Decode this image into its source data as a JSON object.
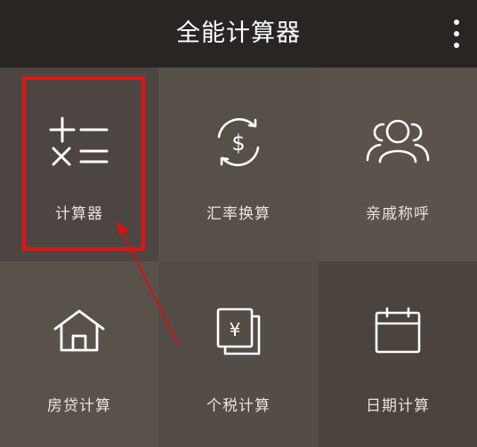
{
  "app": {
    "title": "全能计算器"
  },
  "tiles": [
    {
      "label": "计算器",
      "icon": "calculator-icon",
      "color": "#4d4541"
    },
    {
      "label": "汇率换算",
      "icon": "currency-exchange-icon",
      "color": "#575049"
    },
    {
      "label": "亲戚称呼",
      "icon": "people-group-icon",
      "color": "#5a524b"
    },
    {
      "label": "房贷计算",
      "icon": "house-icon",
      "color": "#59524a"
    },
    {
      "label": "个税计算",
      "icon": "tax-document-icon",
      "color": "#544c46"
    },
    {
      "label": "日期计算",
      "icon": "calendar-icon",
      "color": "#4b433e"
    }
  ],
  "colors": {
    "highlight": "#e8110f",
    "appbar": "#282523"
  }
}
